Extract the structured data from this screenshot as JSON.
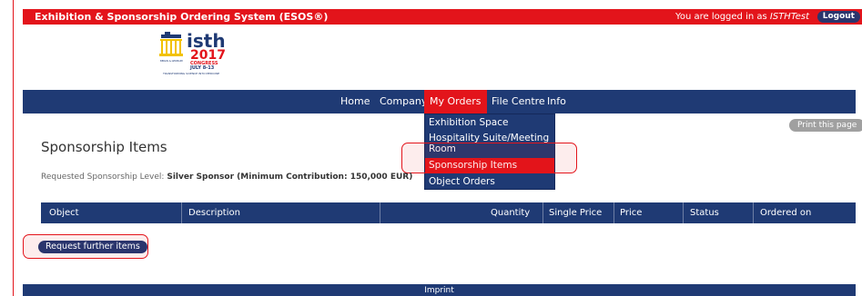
{
  "header": {
    "app_title": "Exhibition & Sponsorship Ordering System (ESOS®)",
    "login_prefix": "You are logged in as ",
    "login_user": "ISTHTest",
    "logout_label": "Logout"
  },
  "logo": {
    "brand": "isth",
    "year": "2017",
    "congress": "CONGRESS",
    "dates": "JULY 8-13",
    "left_text": "BERLIN & GERMANY",
    "tagline": "TRANSFORMING SCIENCE INTO MEDICINE"
  },
  "nav": {
    "items": [
      {
        "label": "Home"
      },
      {
        "label": "Company"
      },
      {
        "label": "My Orders"
      },
      {
        "label": "File Centre"
      },
      {
        "label": "Info"
      }
    ],
    "active": "My Orders"
  },
  "dropdown": {
    "items": [
      {
        "label": "Exhibition Space"
      },
      {
        "label": "Hospitality Suite/Meeting Room"
      },
      {
        "label": "Sponsorship Items"
      },
      {
        "label": "Object Orders"
      }
    ]
  },
  "print_label": "Print this page",
  "page": {
    "title": "Sponsorship Items",
    "level_label": "Requested Sponsorship Level:",
    "level_value": "Silver Sponsor (Minimum Contribution: 150,000 EUR)"
  },
  "table": {
    "columns": [
      "Object",
      "Description",
      "Quantity",
      "Single Price",
      "Price",
      "Status",
      "Ordered on"
    ]
  },
  "request_button_label": "Request further items",
  "footer": {
    "imprint_label": "Imprint"
  },
  "colors": {
    "red": "#e3141b",
    "navy": "#1f3a74",
    "button_navy": "#2a356d",
    "print_grey": "#a0a0a0"
  }
}
